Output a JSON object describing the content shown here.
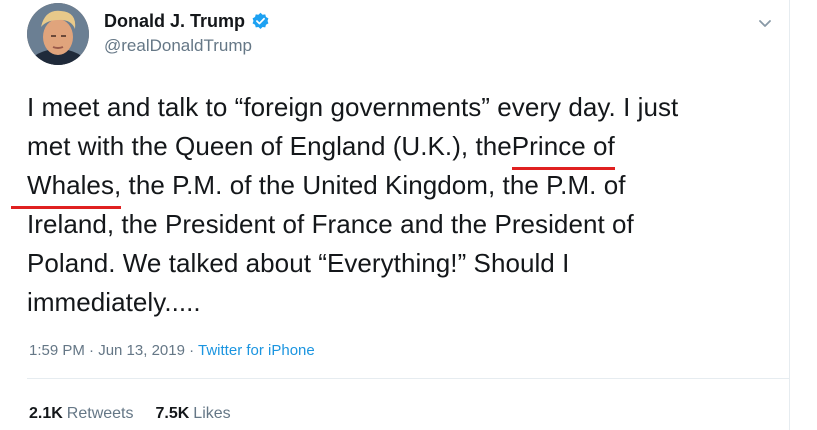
{
  "author": {
    "display_name": "Donald J. Trump",
    "handle": "@realDonaldTrump",
    "verified": true,
    "avatar_icon": "profile-photo"
  },
  "tweet": {
    "lines": [
      {
        "a": "I meet and talk to “foreign governments” every day. I just"
      },
      {
        "a": "met with the Queen of England (U.K.), the",
        "b": " Prince of"
      },
      {
        "a": "Whales,",
        "b": " the P.M. of the United Kingdom, the P.M. of"
      },
      {
        "a": "Ireland, the President of France and the President of"
      },
      {
        "a": "Poland. We talked about “Everything!” Should I"
      },
      {
        "a": "immediately....."
      }
    ],
    "timestamp": "1:59 PM · Jun 13, 2019 ·",
    "source": "Twitter for iPhone"
  },
  "stats": {
    "retweets_count": "2.1K",
    "retweets_label": "Retweets",
    "likes_count": "7.5K",
    "likes_label": "Likes"
  },
  "colors": {
    "link": "#1b95e0",
    "secondary_text": "#657786",
    "annotation_underline": "#e02020",
    "verified_badge": "#1da1f2"
  }
}
